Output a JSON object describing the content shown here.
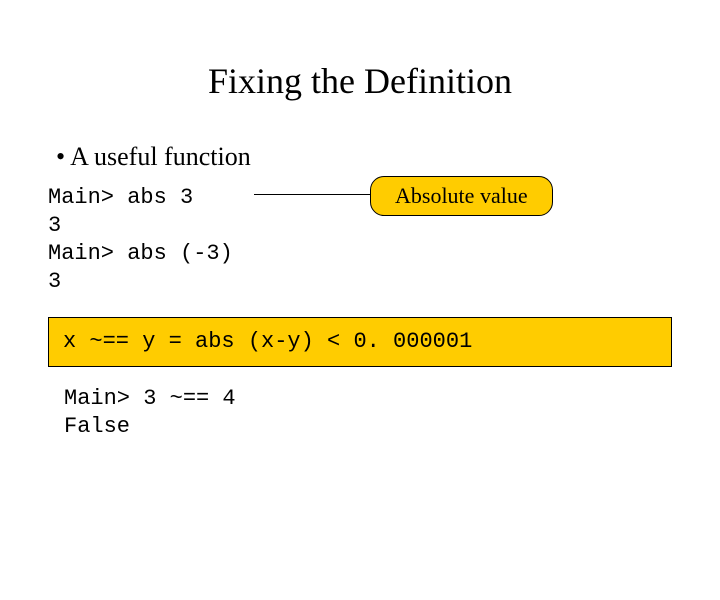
{
  "title": "Fixing the Definition",
  "bullet": "A useful function",
  "code_top": "Main> abs 3\n3\nMain> abs (-3)\n3",
  "callout": "Absolute value",
  "definition": "x ~== y = abs (x-y) < 0. 000001",
  "code_bottom": "Main> 3 ~== 4\nFalse"
}
